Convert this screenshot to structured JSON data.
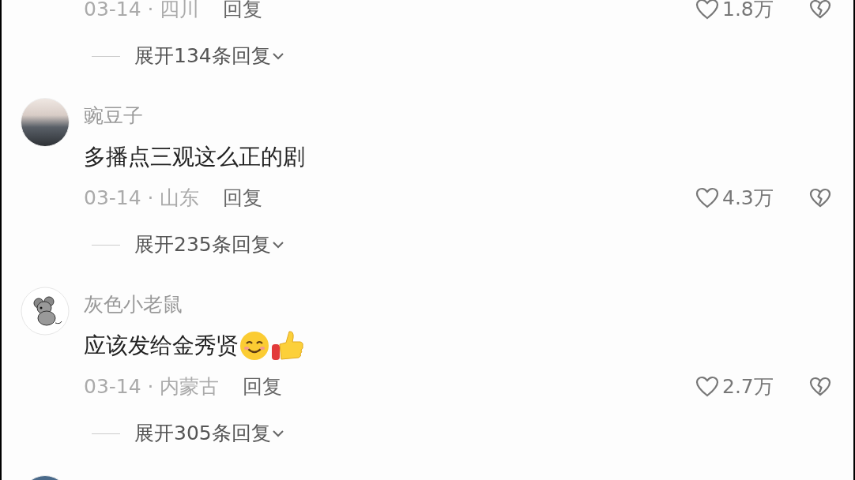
{
  "comments": [
    {
      "meta": "03-14 · 四川",
      "reply": "回复",
      "likes": "1.8万",
      "expand": "展开134条回复"
    },
    {
      "avatar": {
        "kind": "photo"
      },
      "username": "豌豆子",
      "text": "多播点三观这么正的剧",
      "meta": "03-14 · 山东",
      "reply": "回复",
      "likes": "4.3万",
      "expand": "展开235条回复"
    },
    {
      "avatar": {
        "kind": "mouse"
      },
      "username": "灰色小老鼠",
      "text": "应该发给金秀贤",
      "emojis": [
        {
          "kind": "smile"
        },
        {
          "kind": "thumbs_up"
        }
      ],
      "meta": "03-14 · 内蒙古",
      "reply": "回复",
      "likes": "2.7万",
      "expand": "展开305条回复"
    },
    {
      "avatar": {
        "kind": "photo_dark"
      }
    }
  ]
}
